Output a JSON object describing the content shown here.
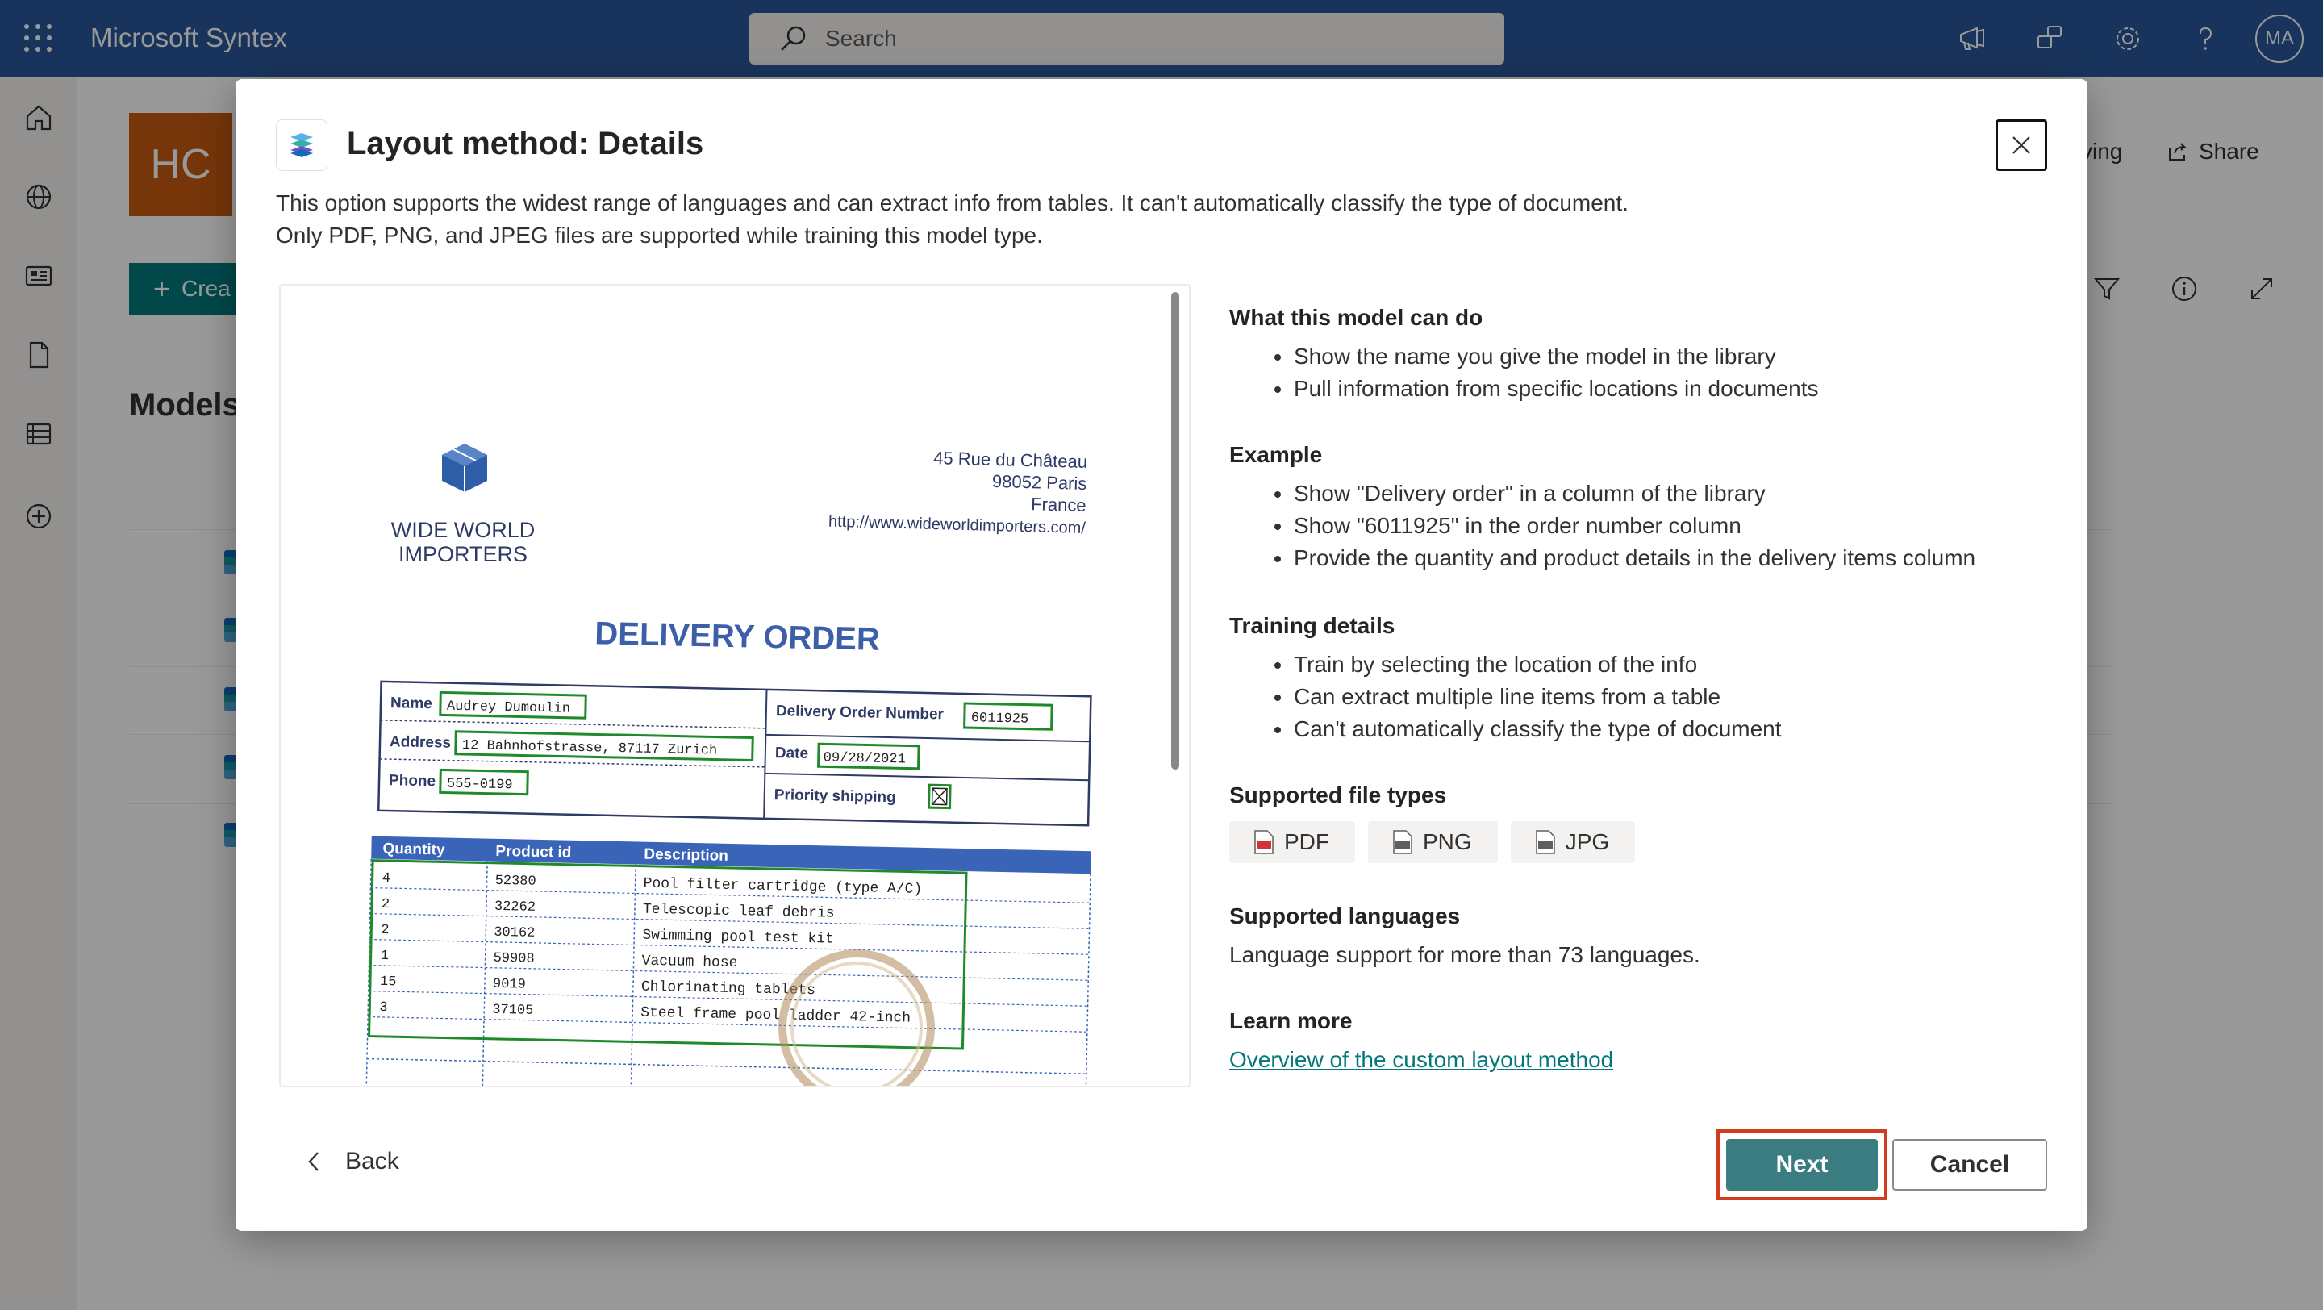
{
  "suitebar": {
    "app_name": "Microsoft Syntex",
    "search_placeholder": "Search",
    "avatar_initials": "MA"
  },
  "site": {
    "logo_initials": "HC",
    "following_label": "ving",
    "share_label": "Share",
    "create_label": "Crea",
    "models_heading": "Models"
  },
  "dialog": {
    "title": "Layout method: Details",
    "description": "This option supports the widest range of languages and can extract info from tables. It can't automatically classify the type of document. Only PDF, PNG, and JPEG files are supported while training this model type.",
    "sections": {
      "can_do": {
        "heading": "What this model can do",
        "items": [
          "Show the name you give the model in the library",
          "Pull information from specific locations in documents"
        ]
      },
      "example": {
        "heading": "Example",
        "items": [
          "Show \"Delivery order\" in a column of the library",
          "Show \"6011925\" in the order number column",
          "Provide the quantity and product details in the delivery items column"
        ]
      },
      "training": {
        "heading": "Training details",
        "items": [
          "Train by selecting the location of the info",
          "Can extract multiple line items from a table",
          "Can't automatically classify the type of document"
        ]
      },
      "file_types": {
        "heading": "Supported file types",
        "types": [
          "PDF",
          "PNG",
          "JPG"
        ]
      },
      "languages": {
        "heading": "Supported languages",
        "text": "Language support for more than 73 languages."
      },
      "learn_more": {
        "heading": "Learn more",
        "link": "Overview of the custom layout method"
      }
    },
    "back_label": "Back",
    "next_label": "Next",
    "cancel_label": "Cancel"
  },
  "sample_document": {
    "company": [
      "WIDE WORLD",
      "IMPORTERS"
    ],
    "address": [
      "45 Rue du Château",
      "98052 Paris",
      "France",
      "http://www.wideworldimporters.com/"
    ],
    "title": "DELIVERY ORDER",
    "fields": {
      "name_label": "Name",
      "name_value": "Audrey Dumoulin",
      "address_label": "Address",
      "address_value": "12 Bahnhofstrasse, 87117 Zurich",
      "phone_label": "Phone",
      "phone_value": "555-0199",
      "order_label": "Delivery Order Number",
      "order_value": "6011925",
      "date_label": "Date",
      "date_value": "09/28/2021",
      "priority_label": "Priority shipping"
    },
    "table_headers": [
      "Quantity",
      "Product id",
      "Description"
    ],
    "table_rows": [
      [
        "4",
        "52380",
        "Pool filter cartridge (type A/C)"
      ],
      [
        "2",
        "32262",
        "Telescopic leaf debris"
      ],
      [
        "2",
        "30162",
        "Swimming pool test kit"
      ],
      [
        "1",
        "59908",
        "Vacuum hose"
      ],
      [
        "15",
        "9019",
        "Chlorinating tablets"
      ],
      [
        "3",
        "37105",
        "Steel frame pool ladder 42-inch"
      ]
    ]
  }
}
